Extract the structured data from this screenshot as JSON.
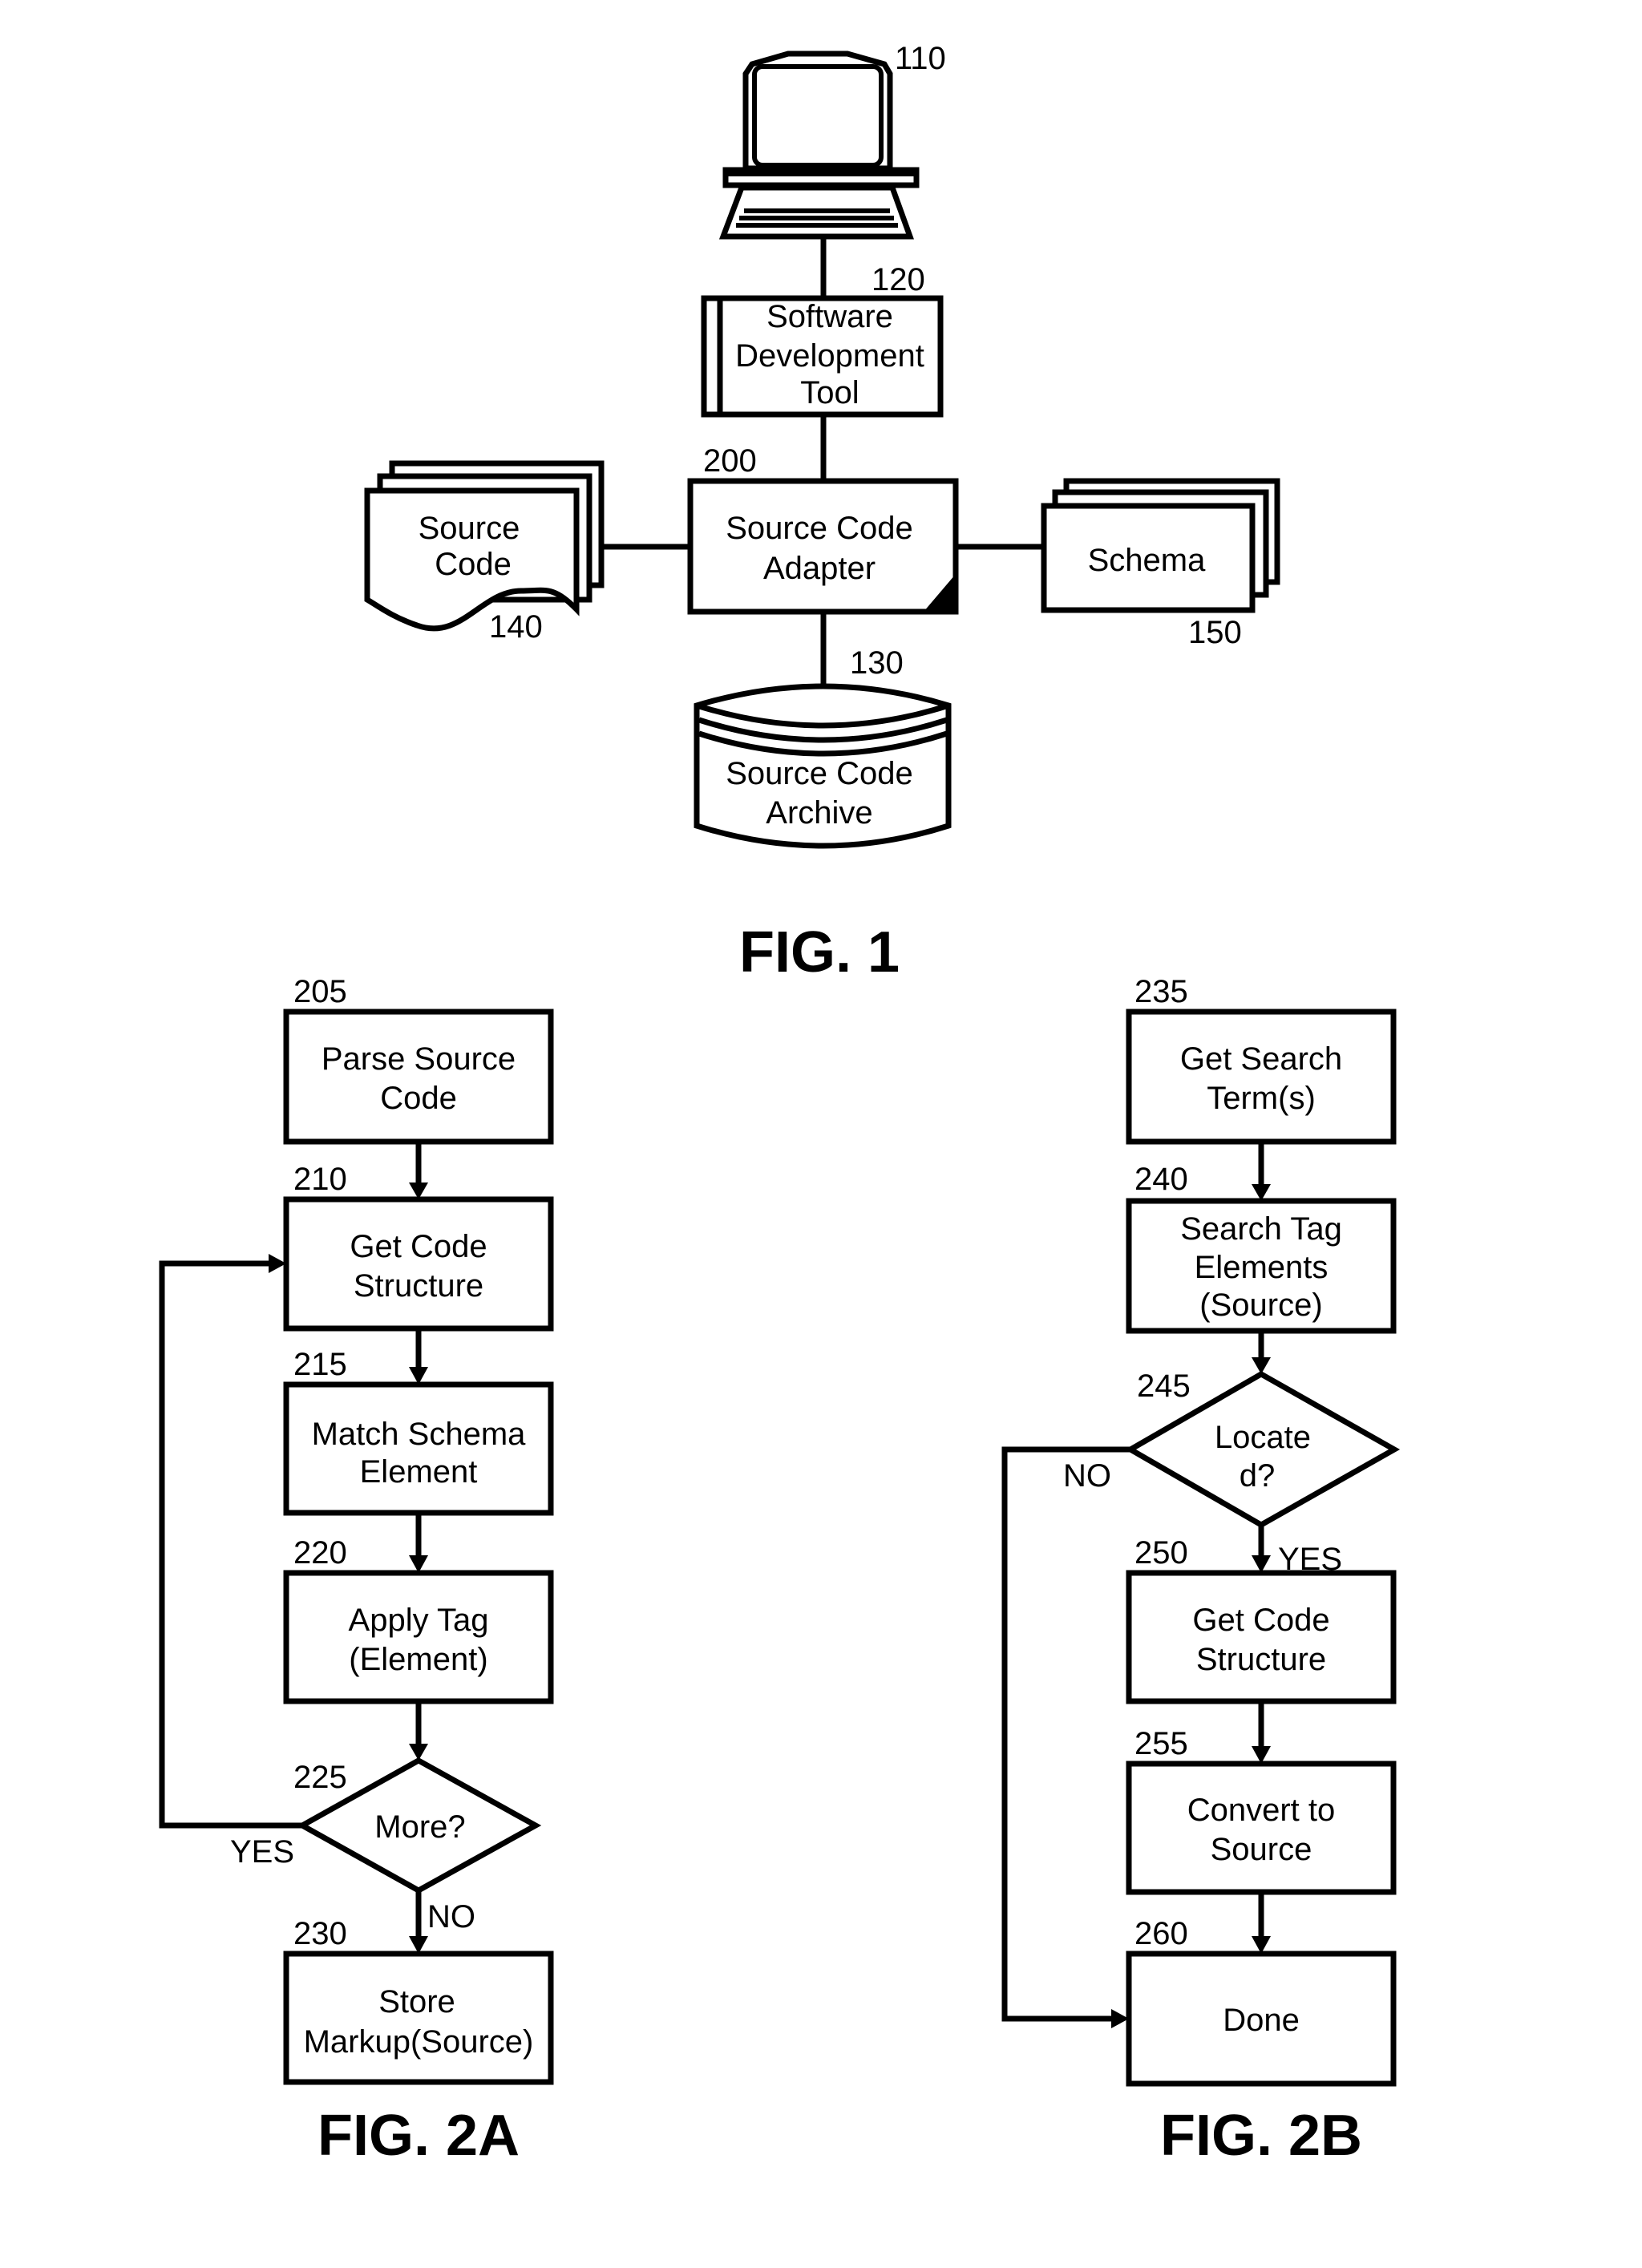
{
  "fig1": {
    "title": "FIG. 1",
    "computer": {
      "ref": "110"
    },
    "dev_tool": {
      "ref": "120",
      "lines": [
        "Software",
        "Development",
        "Tool"
      ]
    },
    "adapter": {
      "ref": "200",
      "lines": [
        "Source Code",
        "Adapter"
      ]
    },
    "source_code": {
      "ref": "140",
      "lines": [
        "Source",
        "Code"
      ]
    },
    "schema": {
      "ref": "150",
      "lines": [
        "Schema"
      ]
    },
    "archive": {
      "ref": "130",
      "lines": [
        "Source Code",
        "Archive"
      ]
    }
  },
  "fig2a": {
    "title": "FIG. 2A",
    "steps": [
      {
        "ref": "205",
        "lines": [
          "Parse Source",
          "Code"
        ]
      },
      {
        "ref": "210",
        "lines": [
          "Get Code",
          "Structure"
        ]
      },
      {
        "ref": "215",
        "lines": [
          "Match Schema",
          "Element"
        ]
      },
      {
        "ref": "220",
        "lines": [
          "Apply Tag",
          "(Element)"
        ]
      },
      {
        "ref": "230",
        "lines": [
          "Store",
          "Markup(Source)"
        ]
      }
    ],
    "decision": {
      "ref": "225",
      "lines": [
        "More?"
      ],
      "yes_label": "YES",
      "no_label": "NO"
    }
  },
  "fig2b": {
    "title": "FIG. 2B",
    "steps": [
      {
        "ref": "235",
        "lines": [
          "Get Search",
          "Term(s)"
        ]
      },
      {
        "ref": "240",
        "lines": [
          "Search Tag",
          "Elements",
          "(Source)"
        ]
      },
      {
        "ref": "250",
        "lines": [
          "Get Code",
          "Structure"
        ]
      },
      {
        "ref": "255",
        "lines": [
          "Convert to",
          "Source"
        ]
      },
      {
        "ref": "260",
        "lines": [
          "Done"
        ]
      }
    ],
    "decision": {
      "ref": "245",
      "lines": [
        "Locate",
        "d?"
      ],
      "yes_label": "YES",
      "no_label": "NO"
    }
  }
}
